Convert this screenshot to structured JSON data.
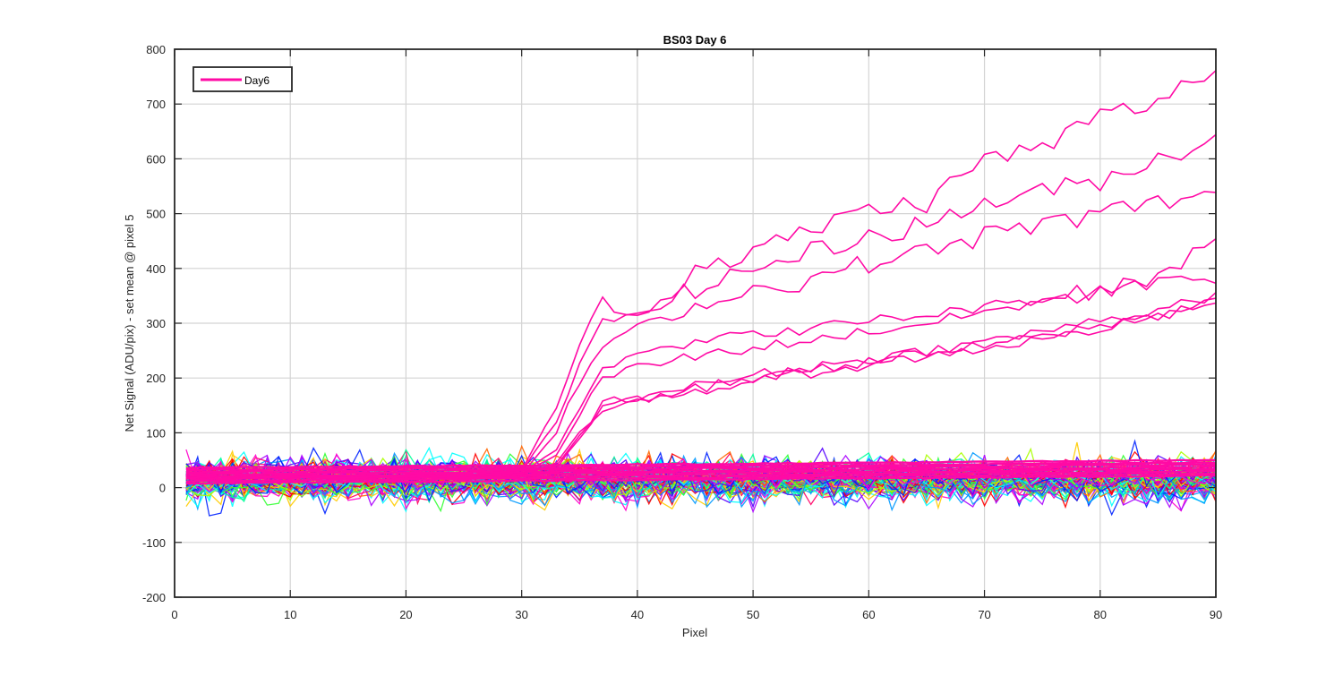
{
  "chart_data": {
    "type": "line",
    "title": "BS03 Day 6",
    "xlabel": "Pixel",
    "ylabel": "Net Signal (ADU/pix) - set mean @ pixel 5",
    "xlim": [
      0,
      90
    ],
    "ylim": [
      -200,
      800
    ],
    "xticks": [
      0,
      10,
      20,
      30,
      40,
      50,
      60,
      70,
      80,
      90
    ],
    "yticks": [
      -200,
      -100,
      0,
      100,
      200,
      300,
      400,
      500,
      600,
      700,
      800
    ],
    "grid": true,
    "legend": {
      "placement": "top-left",
      "entries": [
        {
          "label": "Day6",
          "color": "#ff0aa5"
        }
      ]
    },
    "noise_band": {
      "count": 90,
      "x_start": 1,
      "x_end": 90,
      "colors": [
        "#ff0000",
        "#ff6600",
        "#ffcc00",
        "#aaff00",
        "#33ff33",
        "#00ff99",
        "#00ffff",
        "#0099ff",
        "#0022ff",
        "#5500ff",
        "#aa00ff",
        "#ff00cc",
        "#ff0066"
      ],
      "baseline": 15,
      "spread": 45,
      "seed": 1234
    },
    "smooth_series": [
      {
        "offset": 8,
        "jitter": 2
      },
      {
        "offset": 12,
        "jitter": 2
      },
      {
        "offset": 16,
        "jitter": 2
      },
      {
        "offset": 20,
        "jitter": 2
      },
      {
        "offset": 24,
        "jitter": 2
      },
      {
        "offset": 28,
        "jitter": 2
      },
      {
        "offset": 32,
        "jitter": 2
      },
      {
        "offset": 36,
        "jitter": 2
      }
    ],
    "series": [
      {
        "color": "#ff0aa5",
        "x": [
          1,
          10,
          20,
          30,
          33,
          35,
          37,
          40,
          45,
          50,
          55,
          60,
          65,
          70,
          75,
          80,
          85,
          90
        ],
        "y": [
          18,
          18,
          18,
          20,
          35,
          90,
          140,
          160,
          175,
          195,
          210,
          225,
          240,
          255,
          270,
          290,
          310,
          340
        ]
      },
      {
        "color": "#ff0aa5",
        "x": [
          1,
          10,
          20,
          30,
          33,
          35,
          37,
          40,
          45,
          50,
          55,
          60,
          65,
          70,
          75,
          80,
          85,
          90
        ],
        "y": [
          20,
          20,
          20,
          22,
          40,
          95,
          145,
          165,
          180,
          200,
          215,
          230,
          245,
          260,
          275,
          295,
          315,
          345
        ]
      },
      {
        "color": "#ff0aa5",
        "x": [
          1,
          10,
          20,
          30,
          33,
          35,
          37,
          40,
          45,
          50,
          55,
          60,
          65,
          70,
          75,
          80,
          85,
          90
        ],
        "y": [
          22,
          22,
          22,
          24,
          45,
          100,
          150,
          168,
          185,
          205,
          220,
          235,
          250,
          265,
          285,
          305,
          325,
          360
        ]
      },
      {
        "color": "#ff0aa5",
        "x": [
          1,
          10,
          20,
          30,
          33,
          35,
          37,
          40,
          45,
          50,
          55,
          60,
          65,
          70,
          75,
          80,
          85,
          90
        ],
        "y": [
          20,
          20,
          20,
          25,
          60,
          130,
          200,
          220,
          240,
          255,
          270,
          285,
          300,
          320,
          340,
          360,
          390,
          440
        ]
      },
      {
        "color": "#ff0aa5",
        "x": [
          1,
          10,
          20,
          30,
          33,
          35,
          37,
          40,
          45,
          50,
          55,
          60,
          65,
          70,
          75,
          80,
          85,
          90
        ],
        "y": [
          20,
          20,
          20,
          25,
          70,
          150,
          220,
          250,
          265,
          280,
          290,
          305,
          315,
          330,
          345,
          360,
          380,
          390
        ]
      },
      {
        "color": "#ff0aa5",
        "x": [
          1,
          10,
          20,
          30,
          33,
          35,
          37,
          40,
          45,
          50,
          55,
          60,
          65,
          70,
          75,
          80,
          85,
          90
        ],
        "y": [
          20,
          20,
          20,
          25,
          100,
          190,
          260,
          290,
          330,
          360,
          380,
          410,
          430,
          460,
          480,
          500,
          520,
          540
        ]
      },
      {
        "color": "#ff0aa5",
        "x": [
          1,
          10,
          20,
          30,
          33,
          35,
          37,
          40,
          45,
          50,
          55,
          60,
          65,
          70,
          75,
          80,
          85,
          90
        ],
        "y": [
          20,
          20,
          20,
          30,
          120,
          220,
          300,
          320,
          360,
          400,
          430,
          460,
          480,
          520,
          540,
          560,
          600,
          640
        ]
      },
      {
        "color": "#ff0aa5",
        "x": [
          1,
          10,
          20,
          30,
          33,
          35,
          37,
          40,
          45,
          50,
          55,
          60,
          65,
          70,
          75,
          80,
          85,
          90
        ],
        "y": [
          20,
          20,
          20,
          30,
          150,
          260,
          340,
          310,
          400,
          430,
          470,
          510,
          520,
          600,
          620,
          680,
          700,
          770
        ]
      }
    ]
  }
}
